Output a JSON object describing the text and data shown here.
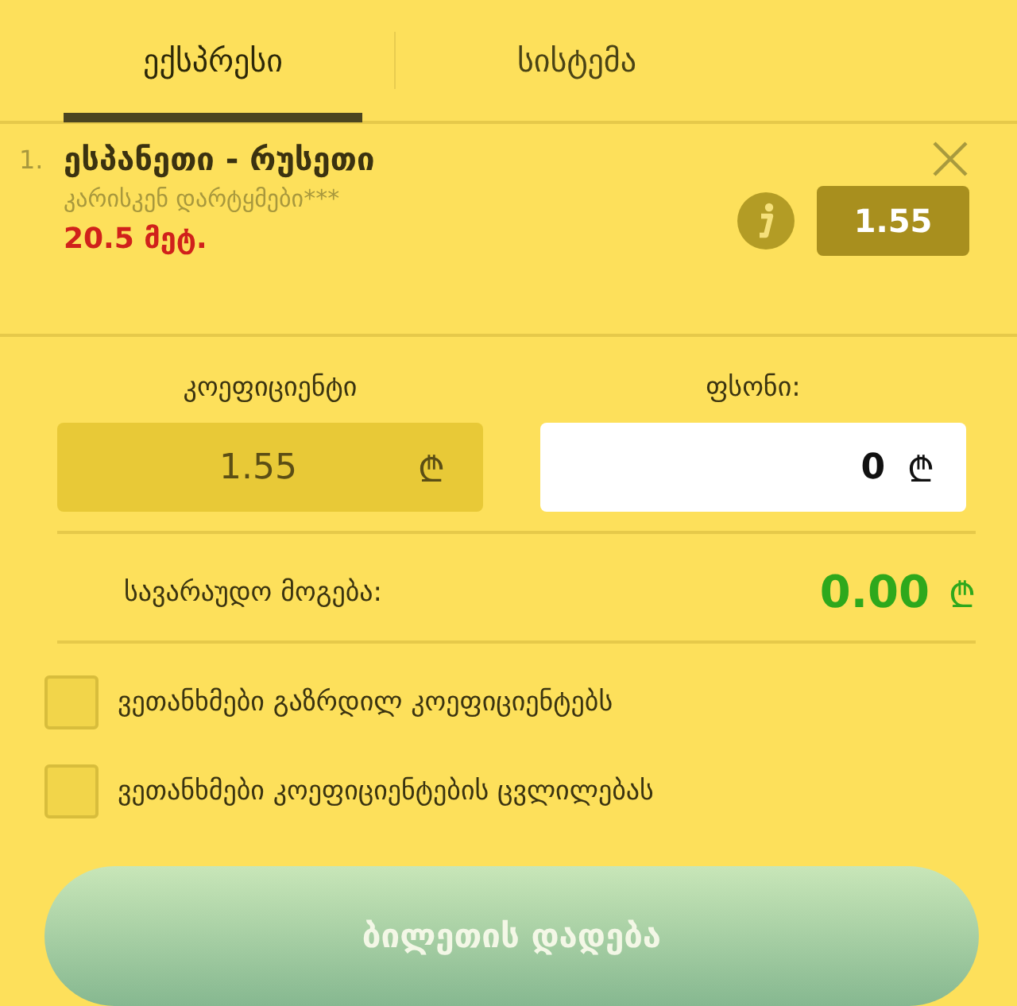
{
  "tabs": [
    {
      "label": "ექსპრესი",
      "selected": true
    },
    {
      "label": "სისტემა",
      "selected": false
    }
  ],
  "bet": {
    "number": "1.",
    "title": "ესპანეთი - რუსეთი",
    "market": "კარისკენ დარტყმები***",
    "line": "20.5 მეტ.",
    "odds": "1.55"
  },
  "odds_field": {
    "label": "კოეფიციენტი",
    "value": "1.55",
    "currency": "₾"
  },
  "stake_field": {
    "label": "ფსონი:",
    "value": "0",
    "currency": "₾"
  },
  "potential_win": {
    "label": "სავარაუდო მოგება:",
    "value": "0.00",
    "currency": "₾"
  },
  "options": [
    {
      "label": "ვეთანხმები გაზრდილ კოეფიციენტებს",
      "checked": false
    },
    {
      "label": "ვეთანხმები კოეფიციენტების ცვლილებას",
      "checked": false
    }
  ],
  "submit_button": "ბილეთის დადება"
}
